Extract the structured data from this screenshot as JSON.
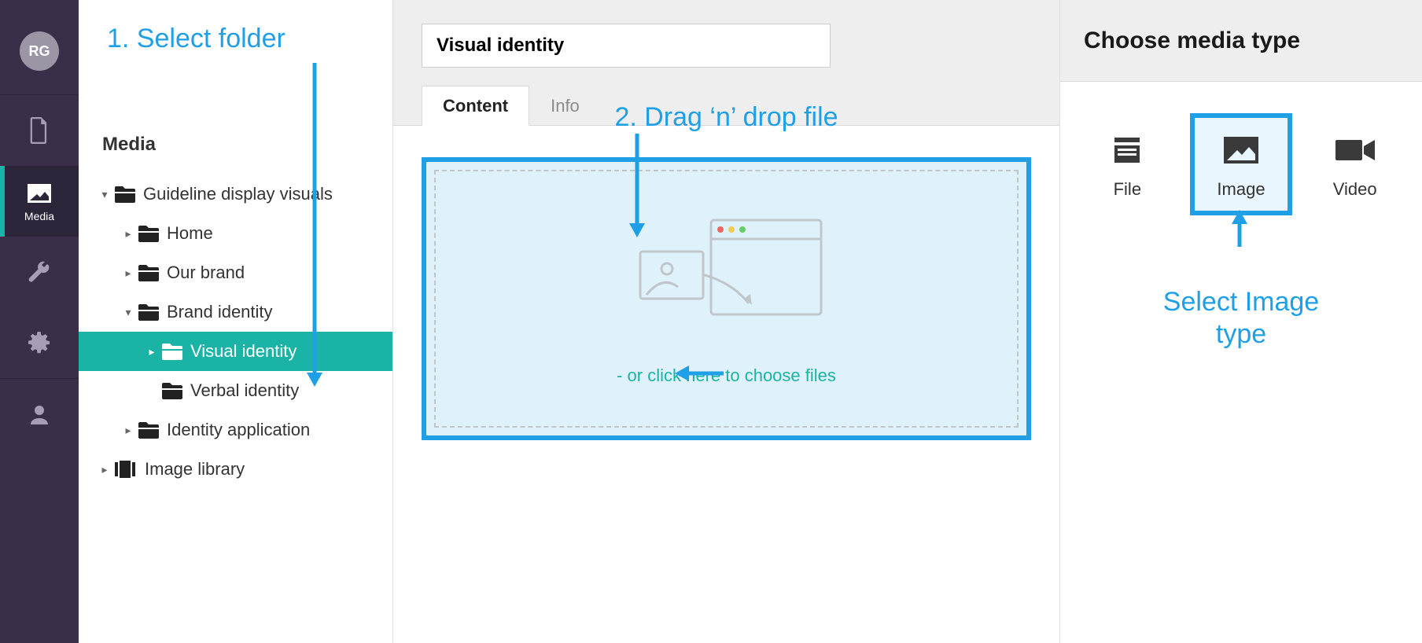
{
  "rail": {
    "avatar_initials": "RG",
    "items": [
      {
        "name": "content",
        "label": ""
      },
      {
        "name": "media",
        "label": "Media"
      },
      {
        "name": "settings-wrench",
        "label": ""
      },
      {
        "name": "settings-gear",
        "label": ""
      },
      {
        "name": "users",
        "label": ""
      }
    ]
  },
  "tree": {
    "heading": "Media",
    "nodes": {
      "root": {
        "label": "Guideline display visuals"
      },
      "home": {
        "label": "Home"
      },
      "brand": {
        "label": "Our brand"
      },
      "bident": {
        "label": "Brand identity"
      },
      "visual": {
        "label": "Visual identity"
      },
      "verbal": {
        "label": "Verbal identity"
      },
      "idapp": {
        "label": "Identity application"
      },
      "imglib": {
        "label": "Image library"
      }
    }
  },
  "main": {
    "title_value": "Visual identity",
    "tabs": {
      "content": "Content",
      "info": "Info"
    },
    "dropzone_link": "- or click here to choose files"
  },
  "right": {
    "heading": "Choose media type",
    "cards": {
      "file": "File",
      "image": "Image",
      "video": "Video"
    }
  },
  "annotations": {
    "a1": "1. Select folder",
    "a2": "2. Drag ‘n’ drop file",
    "a3": "Select Image type"
  }
}
